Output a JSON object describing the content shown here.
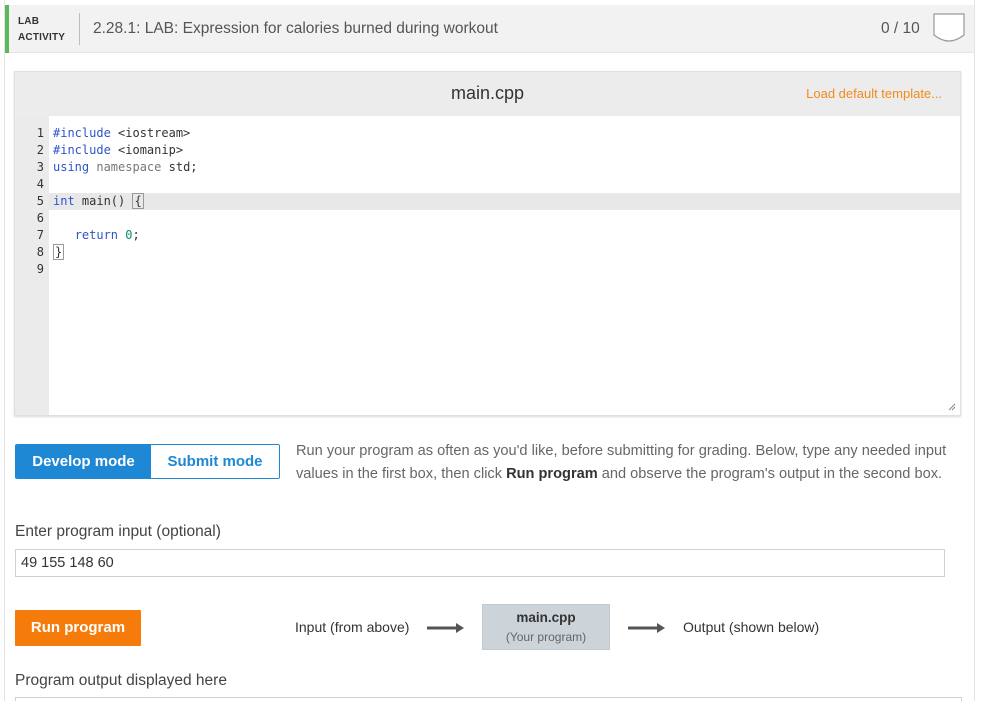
{
  "header": {
    "label_line1": "LAB",
    "label_line2": "ACTIVITY",
    "title": "2.28.1: LAB: Expression for calories burned during workout",
    "score": "0 / 10",
    "accent_color": "#5cb85c"
  },
  "editor": {
    "file_name": "main.cpp",
    "load_template": "Load default template...",
    "lines": [
      {
        "no": "1"
      },
      {
        "no": "2"
      },
      {
        "no": "3"
      },
      {
        "no": "4"
      },
      {
        "no": "5"
      },
      {
        "no": "6"
      },
      {
        "no": "7"
      },
      {
        "no": "8"
      },
      {
        "no": "9"
      }
    ],
    "code": {
      "l1_directive": "#include",
      "l1_header": " <iostream>",
      "l2_directive": "#include",
      "l2_header": " <iomanip>",
      "l3_using": "using",
      "l3_namespace": "namespace",
      "l3_rest": " std;",
      "l5_int": "int",
      "l5_rest": " main() ",
      "l5_brace": "{",
      "l7_indent": "   ",
      "l7_return": "return",
      "l7_num": "0",
      "l7_semi": ";",
      "l8_brace": "}"
    }
  },
  "modes": {
    "develop": "Develop mode",
    "submit": "Submit mode",
    "active": "develop",
    "active_color": "#1e88d4"
  },
  "instructions": {
    "part1": "Run your program as often as you'd like, before submitting for grading. Below, type any needed input values in the first box, then click ",
    "bold": "Run program",
    "part2": " and observe the program's output in the second box."
  },
  "input": {
    "label": "Enter program input (optional)",
    "value": "49 155 148 60"
  },
  "run": {
    "button": "Run program",
    "button_color": "#f57c0b",
    "flow_input": "Input (from above)",
    "flow_program": "main.cpp",
    "flow_program_sub": "(Your program)",
    "flow_output": "Output (shown below)"
  },
  "output": {
    "label": "Program output displayed here"
  }
}
